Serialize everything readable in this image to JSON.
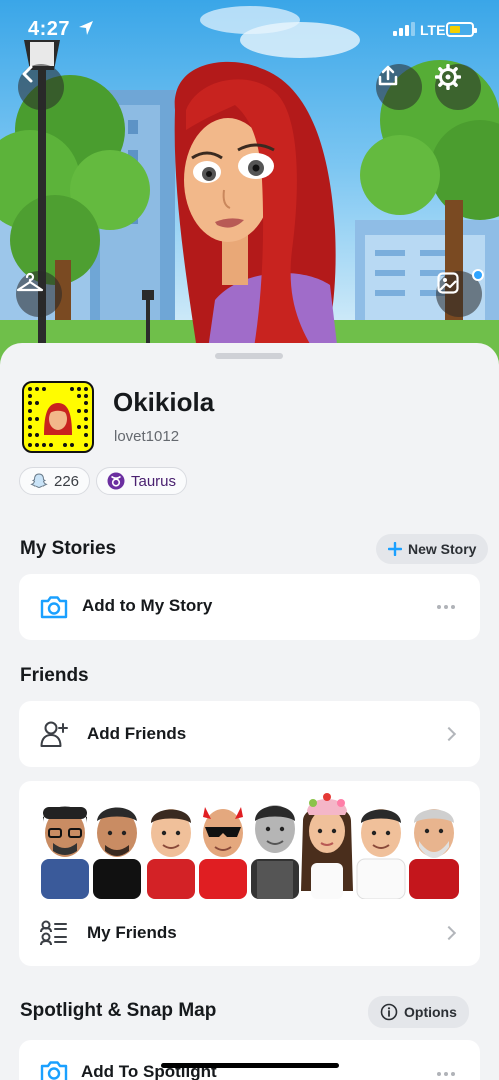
{
  "status_bar": {
    "time": "4:27",
    "network": "LTE"
  },
  "profile": {
    "display_name": "Okikiola",
    "username": "lovet1012",
    "snapscore": "226",
    "zodiac": "Taurus"
  },
  "my_stories": {
    "title": "My Stories",
    "new_story_label": "New Story",
    "add_story_label": "Add to My Story"
  },
  "friends": {
    "title": "Friends",
    "add_friends_label": "Add Friends",
    "my_friends_label": "My Friends",
    "friend_avatar_count": 8
  },
  "spotlight": {
    "title": "Spotlight & Snap Map",
    "options_label": "Options",
    "add_spotlight_label": "Add To Spotlight"
  },
  "icons": [
    "back-icon",
    "upload-icon",
    "gear-icon",
    "hanger-icon",
    "photo-icon",
    "snapscore-icon",
    "taurus-icon",
    "plus-icon",
    "camera-icon",
    "more-icon",
    "add-friend-icon",
    "chevron-right-icon",
    "friends-list-icon",
    "info-icon"
  ],
  "colors": {
    "accent_blue": "#1aa0ff",
    "snapcode_yellow": "#fffc00",
    "zodiac_purple": "#6b2fa0"
  }
}
